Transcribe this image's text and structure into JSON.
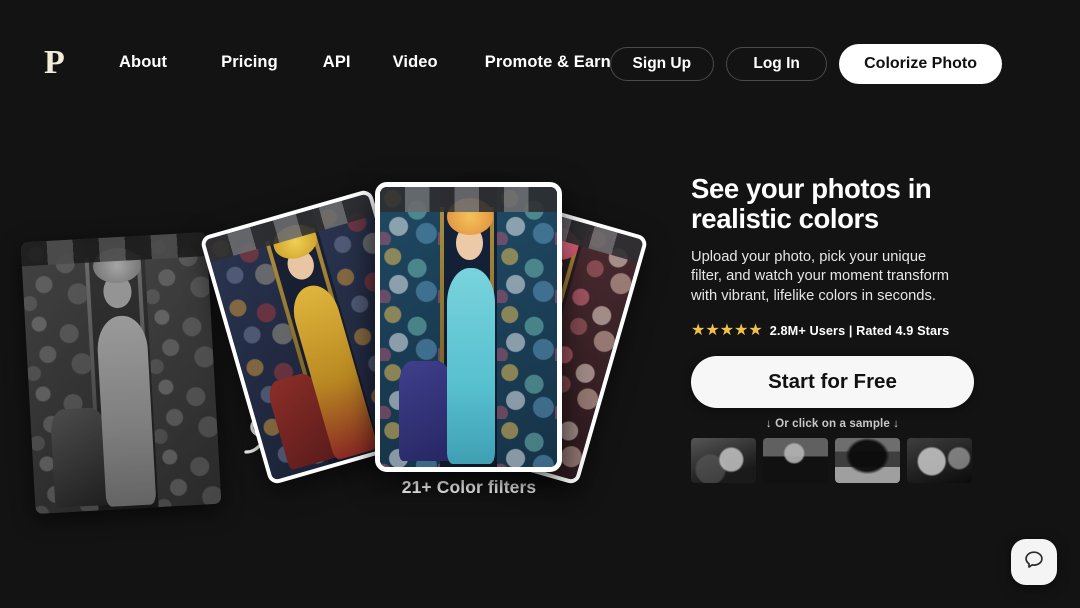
{
  "brand": {
    "logo_text": "P"
  },
  "nav": {
    "items": [
      {
        "label": "About"
      },
      {
        "label": "Pricing"
      },
      {
        "label": "API"
      },
      {
        "label": "Video"
      },
      {
        "label": "Promote & Earn"
      }
    ]
  },
  "header_actions": {
    "sign_up": "Sign Up",
    "log_in": "Log In",
    "colorize": "Colorize Photo"
  },
  "hero": {
    "headline": "See your photos in realistic colors",
    "subcopy": "Upload your photo, pick your unique filter, and watch your moment transform with vibrant, lifelike colors in seconds.",
    "rating": {
      "stars_glyphs": "★★★★★",
      "stars_count": 5,
      "users": "2.8M+ Users",
      "separator": "|",
      "score": "Rated 4.9 Stars",
      "full_text": "2.8M+ Users | Rated 4.9 Stars",
      "star_color": "#f2c14a"
    },
    "cta_label": "Start for Free",
    "sample_hint": "↓ Or click on a sample ↓"
  },
  "gallery": {
    "caption": "21+ Color filters",
    "before_photo_alt": "black-and-white vintage portrait of woman in embroidered robe",
    "cards": [
      {
        "alt": "colorized portrait gold filter",
        "tint": "gold"
      },
      {
        "alt": "colorized portrait blue filter",
        "tint": "blue"
      },
      {
        "alt": "colorized portrait pink filter",
        "tint": "pink"
      }
    ],
    "arrow_alt": "hand-drawn curly arrow pointing to colorized results"
  },
  "samples": [
    {
      "alt": "vintage group photo sample"
    },
    {
      "alt": "vintage portrait of man in suit sample"
    },
    {
      "alt": "vintage street scene sample"
    },
    {
      "alt": "vintage portrait of woman sample"
    }
  ],
  "chat": {
    "icon": "chat-bubble-icon"
  },
  "colors": {
    "background": "#141314",
    "accent_white": "#ffffff",
    "logo_cream": "#f3ecd8",
    "star_gold": "#f2c14a"
  }
}
